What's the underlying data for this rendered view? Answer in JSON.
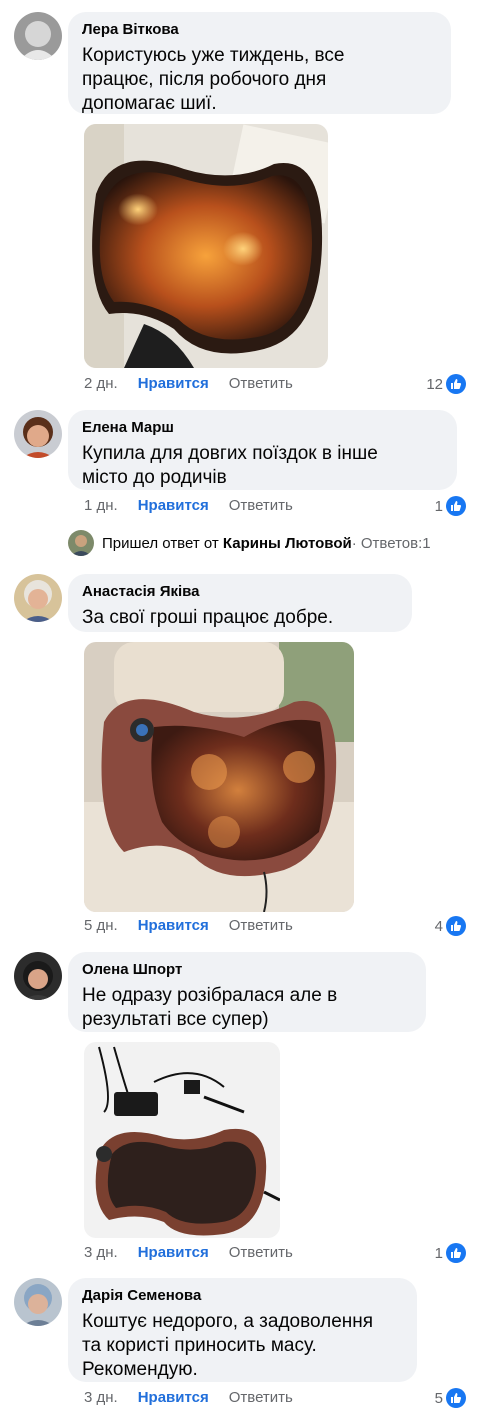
{
  "comments": [
    {
      "author": "Лера Віткова",
      "text": "Користуюсь уже тиждень, все\nпрацює, після робочого дня\nдопомагає шиї.",
      "time": "2 дн.",
      "like_label": "Нравится",
      "reply_label": "Ответить",
      "reactions": "12",
      "image": "massage-pillow-photo"
    },
    {
      "author": "Елена Марш",
      "text": "Купила для довгих поїздок в інше\nмісто до родичів",
      "time": "1 дн.",
      "like_label": "Нравится",
      "reply_label": "Ответить",
      "reactions": "1"
    },
    {
      "author": "Анастасія Яківа",
      "text": "За свої гроші працює добре.",
      "time": "5 дн.",
      "like_label": "Нравится",
      "reply_label": "Ответить",
      "reactions": "4",
      "image": "massage-pillow-car-seat-photo"
    },
    {
      "author": "Олена Шпорт",
      "text": "Не одразу розібралася але в\nрезультаті все супер)",
      "time": "3 дн.",
      "like_label": "Нравится",
      "reply_label": "Ответить",
      "reactions": "1",
      "image": "massage-pillow-with-chargers-photo"
    },
    {
      "author": "Дарія Семенова",
      "text": "Коштує недорого, а задоволення\nта користі приносить масу.\nРекомендую.",
      "time": "3 дн.",
      "like_label": "Нравится",
      "reply_label": "Ответить",
      "reactions": "5"
    }
  ],
  "reply_notice": {
    "prefix": "Пришел ответ от",
    "name": "Карины Лютовой",
    "separator": "·",
    "count_label": "Ответов:1"
  },
  "colors": {
    "bubble": "#f0f2f5",
    "like_text": "#216fdb",
    "like_badge": "#1877f2",
    "meta_text": "#65676b"
  }
}
